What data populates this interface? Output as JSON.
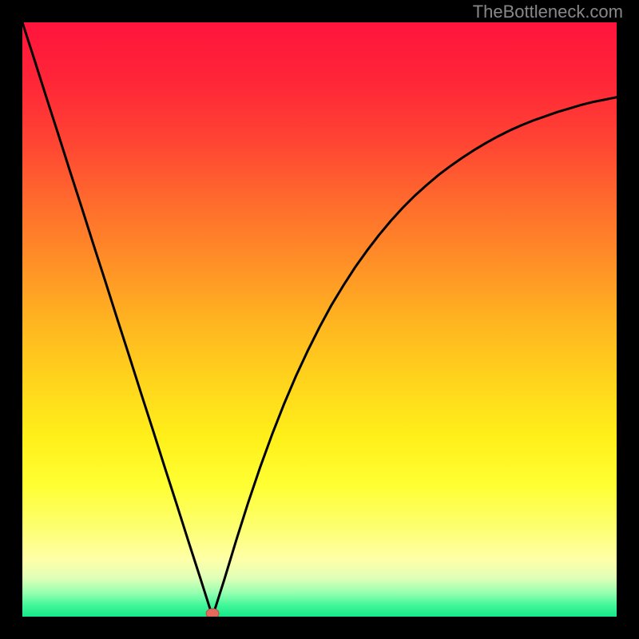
{
  "watermark": "TheBottleneck.com",
  "colors": {
    "frame": "#000000",
    "curve": "#000000",
    "marker_fill": "#e46a5e",
    "marker_stroke": "#b84d42",
    "grad_stops": [
      {
        "offset": 0.0,
        "color": "#ff143c"
      },
      {
        "offset": 0.1,
        "color": "#ff2638"
      },
      {
        "offset": 0.2,
        "color": "#ff4433"
      },
      {
        "offset": 0.3,
        "color": "#ff6a2d"
      },
      {
        "offset": 0.4,
        "color": "#ff8e27"
      },
      {
        "offset": 0.5,
        "color": "#ffb321"
      },
      {
        "offset": 0.6,
        "color": "#ffd31c"
      },
      {
        "offset": 0.7,
        "color": "#fff01a"
      },
      {
        "offset": 0.78,
        "color": "#ffff33"
      },
      {
        "offset": 0.85,
        "color": "#fdff70"
      },
      {
        "offset": 0.905,
        "color": "#feffa8"
      },
      {
        "offset": 0.935,
        "color": "#e0ffb8"
      },
      {
        "offset": 0.96,
        "color": "#96ffb0"
      },
      {
        "offset": 0.98,
        "color": "#44f79a"
      },
      {
        "offset": 1.0,
        "color": "#14e889"
      }
    ]
  },
  "chart_data": {
    "type": "line",
    "title": "",
    "xlabel": "",
    "ylabel": "",
    "xlim": [
      0,
      1
    ],
    "ylim": [
      0,
      1
    ],
    "minimum_x": 0.32,
    "marker": {
      "x": 0.32,
      "y": 0.0
    },
    "x": [
      0.0,
      0.02,
      0.04,
      0.06,
      0.08,
      0.1,
      0.12,
      0.14,
      0.16,
      0.18,
      0.2,
      0.22,
      0.24,
      0.26,
      0.28,
      0.3,
      0.32,
      0.34,
      0.36,
      0.38,
      0.4,
      0.42,
      0.44,
      0.46,
      0.48,
      0.5,
      0.52,
      0.54,
      0.56,
      0.58,
      0.6,
      0.62,
      0.64,
      0.66,
      0.68,
      0.7,
      0.72,
      0.74,
      0.76,
      0.78,
      0.8,
      0.82,
      0.84,
      0.86,
      0.88,
      0.9,
      0.92,
      0.94,
      0.96,
      0.98,
      1.0
    ],
    "y": [
      1.0,
      0.938,
      0.875,
      0.813,
      0.75,
      0.688,
      0.625,
      0.563,
      0.5,
      0.438,
      0.375,
      0.313,
      0.25,
      0.188,
      0.125,
      0.063,
      0.0,
      0.063,
      0.129,
      0.192,
      0.251,
      0.306,
      0.357,
      0.404,
      0.447,
      0.487,
      0.524,
      0.557,
      0.588,
      0.616,
      0.642,
      0.666,
      0.688,
      0.708,
      0.726,
      0.743,
      0.758,
      0.772,
      0.785,
      0.797,
      0.808,
      0.818,
      0.827,
      0.835,
      0.842,
      0.849,
      0.855,
      0.861,
      0.866,
      0.87,
      0.874
    ]
  }
}
